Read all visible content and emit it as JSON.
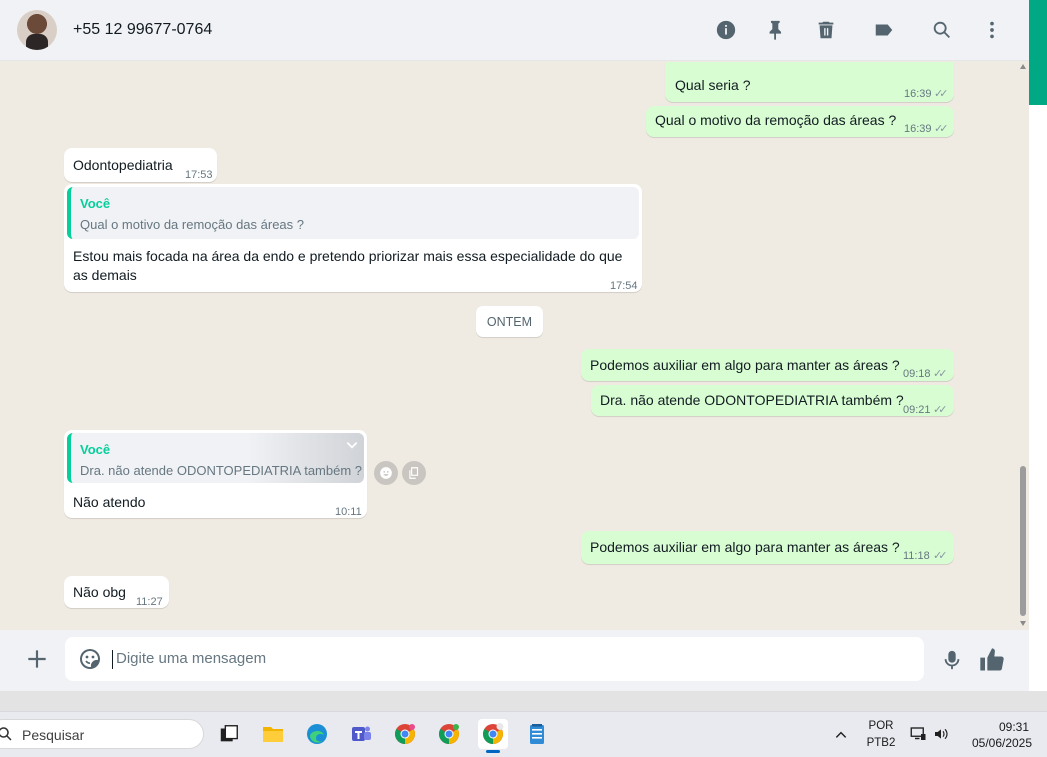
{
  "header": {
    "contact_name": "+55 12 99677-0764"
  },
  "messages": [
    {
      "id": "m1",
      "direction": "out",
      "text": "Qual seria ?",
      "time": "16:39"
    },
    {
      "id": "m2",
      "direction": "out",
      "text": "Qual o motivo da remoção das áreas ?",
      "time": "16:39"
    },
    {
      "id": "m3",
      "direction": "in",
      "text": "Odontopediatria",
      "time": "17:53"
    },
    {
      "id": "m4",
      "direction": "in",
      "quote_author": "Você",
      "quote_text": "Qual o motivo da remoção das áreas ?",
      "text_line1": "Estou mais focada na área da endo e pretendo priorizar mais essa especialidade do que",
      "text_line2": "as demais",
      "time": "17:54"
    },
    {
      "id": "m5",
      "direction": "out",
      "text": "Podemos auxiliar em algo para manter as áreas ?",
      "time": "09:18"
    },
    {
      "id": "m6",
      "direction": "out",
      "text": "Dra. não atende ODONTOPEDIATRIA também ?",
      "time": "09:21"
    },
    {
      "id": "m7",
      "direction": "in",
      "quote_author": "Você",
      "quote_text": "Dra. não atende ODONTOPEDIATRIA também ?",
      "text": "Não atendo",
      "time": "10:11"
    },
    {
      "id": "m8",
      "direction": "out",
      "text": "Podemos auxiliar em algo para manter as áreas ?",
      "time": "11:18"
    },
    {
      "id": "m9",
      "direction": "in",
      "text": "Não obg",
      "time": "11:27"
    }
  ],
  "date_divider": "ONTEM",
  "composer": {
    "placeholder": "Digite uma mensagem"
  },
  "taskbar": {
    "search_label": "Pesquisar",
    "language_line1": "POR",
    "language_line2": "PTB2",
    "clock_time": "09:31",
    "clock_date": "05/06/2025"
  },
  "colors": {
    "accent": "#00a884",
    "outgoing_bubble": "#d9fdd3",
    "incoming_bubble": "#ffffff",
    "chat_background": "#efeae2",
    "quote_author": "#06cf9c"
  },
  "icons": {
    "header": [
      "info-icon",
      "pin-icon",
      "delete-icon",
      "label-icon",
      "search-icon",
      "menu-icon"
    ],
    "composer": [
      "plus-icon",
      "sticker-icon",
      "mic-icon",
      "like-icon"
    ]
  }
}
